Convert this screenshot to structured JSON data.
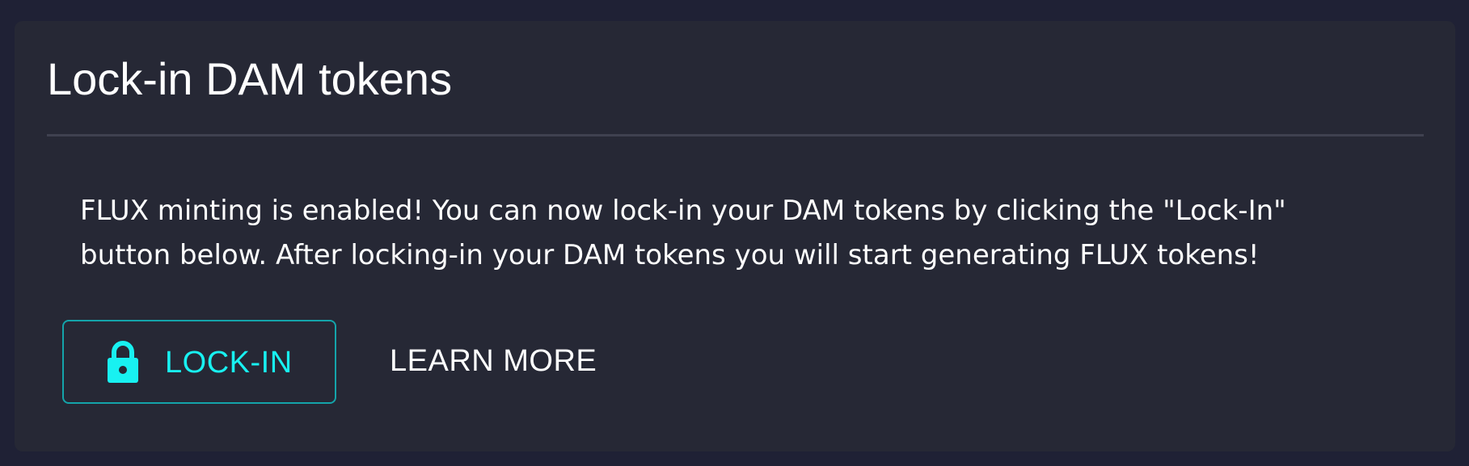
{
  "card": {
    "title": "Lock-in DAM tokens",
    "description": "FLUX minting is enabled! You can now lock-in your DAM tokens by clicking the \"Lock-In\" button below. After locking-in your DAM tokens you will start generating FLUX tokens!"
  },
  "actions": {
    "lockin_label": "LOCK-IN",
    "lockin_icon": "lock-icon",
    "learn_more_label": "LEARN MORE"
  },
  "colors": {
    "page_background": "#1f2135",
    "card_background": "#262835",
    "accent": "#18f1f1",
    "accent_border": "#14a4aa",
    "text": "#ffffff",
    "divider": "#3f4150"
  }
}
